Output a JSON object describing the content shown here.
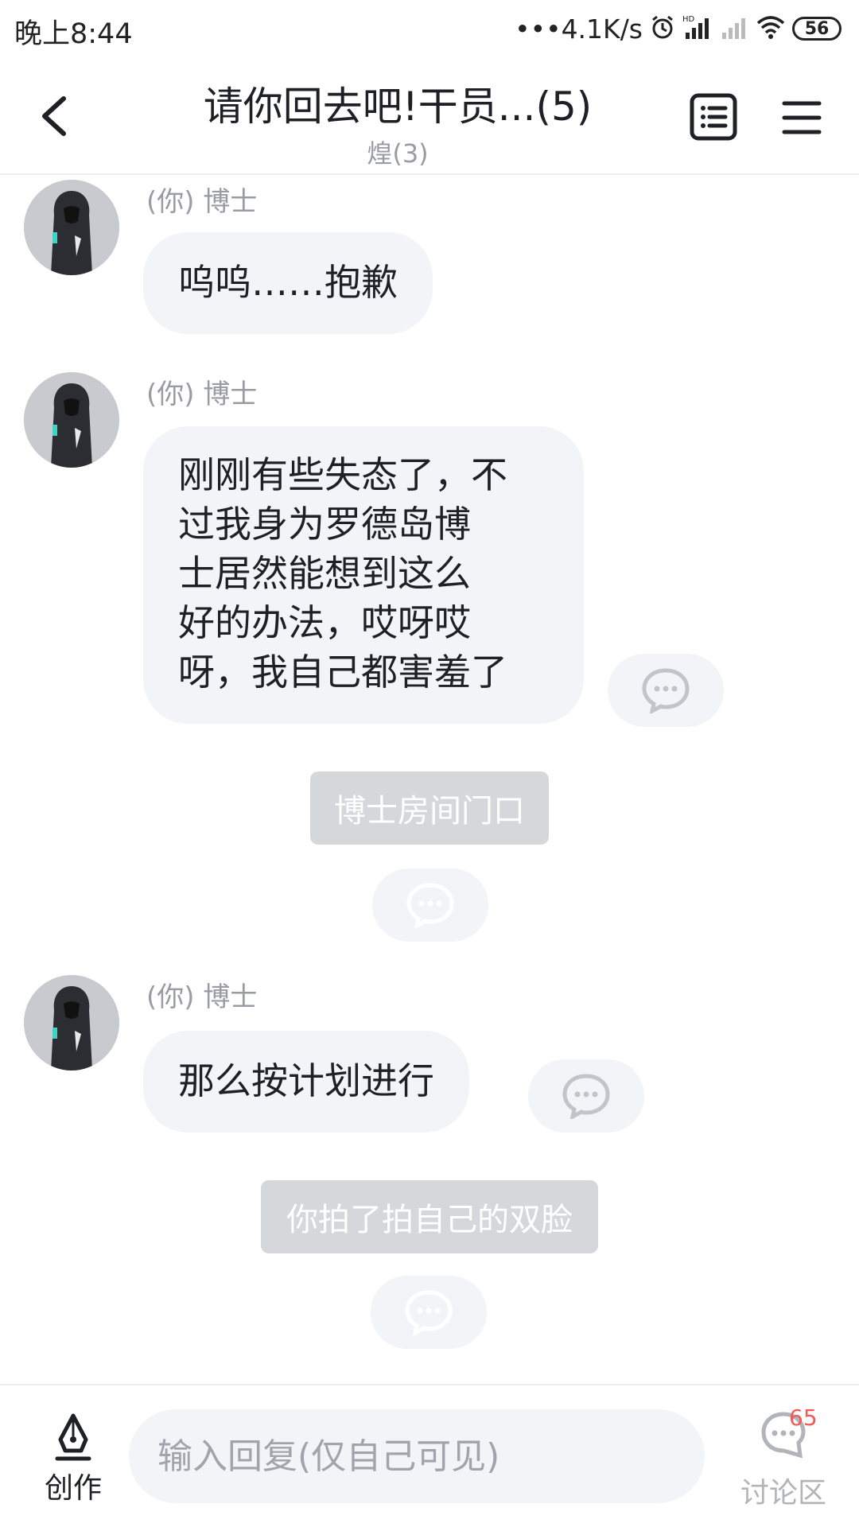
{
  "status_bar": {
    "time": "晚上8:44",
    "net_speed": "•••4.1K/s",
    "battery": "56"
  },
  "header": {
    "title": "请你回去吧!干员...(5)",
    "subtitle": "煌(3)"
  },
  "messages": [
    {
      "sender": "(你) 博士",
      "text": "呜呜……抱歉"
    },
    {
      "sender": "(你) 博士",
      "lines": [
        "刚刚有些失态了，不",
        "过我身为罗德岛博",
        "士居然能想到这么",
        "好的办法，哎呀哎",
        "呀，我自己都害羞了"
      ]
    },
    {
      "narration": "博士房间门口"
    },
    {
      "sender": "(你) 博士",
      "text": "那么按计划进行"
    },
    {
      "narration": "你拍了拍自己的双脸"
    }
  ],
  "bottom_bar": {
    "create_label": "创作",
    "reply_placeholder": "输入回复(仅自己可见)",
    "discuss_label": "讨论区",
    "discuss_count": "65"
  },
  "icons": {
    "back": "back-icon",
    "list": "list-icon",
    "menu": "menu-icon",
    "comment": "comment-icon",
    "pen": "pen-nib-icon",
    "discuss": "discussion-icon"
  },
  "colors": {
    "bubble": "#f3f4f7",
    "narration": "#d6d7db",
    "badge": "#f35a57",
    "muted_text": "#9a9ba3"
  }
}
